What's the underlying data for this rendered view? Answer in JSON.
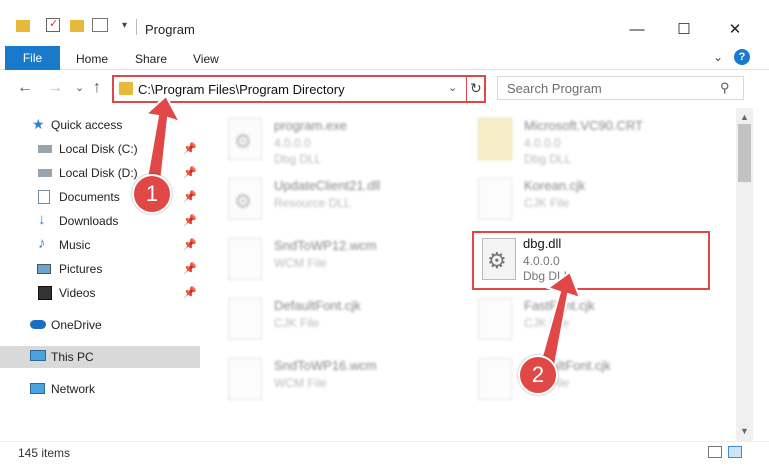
{
  "window": {
    "title": "Program",
    "minimize": "—",
    "maximize": "☐",
    "close": "✕"
  },
  "ribbon": {
    "file": "File",
    "tabs": [
      "Home",
      "Share",
      "View"
    ],
    "expand": "⌄",
    "help": "?"
  },
  "nav": {
    "back": "←",
    "forward": "→",
    "recent": "⌄",
    "up": "↑",
    "address": "C:\\Program Files\\Program Directory",
    "address_dropdown": "⌄",
    "refresh": "↻",
    "search_placeholder": "Search Program",
    "search_icon": "⚲"
  },
  "sidebar": {
    "items": [
      {
        "label": "Quick access",
        "icon": "star-icon",
        "pinned": false
      },
      {
        "label": "Local Disk (C:)",
        "icon": "drive-icon",
        "pinned": true
      },
      {
        "label": "Local Disk (D:)",
        "icon": "drive-icon",
        "pinned": true
      },
      {
        "label": "Documents",
        "icon": "documents-icon",
        "pinned": true
      },
      {
        "label": "Downloads",
        "icon": "download-icon",
        "pinned": true
      },
      {
        "label": "Music",
        "icon": "music-icon",
        "pinned": true
      },
      {
        "label": "Pictures",
        "icon": "pictures-icon",
        "pinned": true
      },
      {
        "label": "Videos",
        "icon": "videos-icon",
        "pinned": true
      },
      {
        "label": "OneDrive",
        "icon": "cloud-icon",
        "pinned": false
      },
      {
        "label": "This PC",
        "icon": "computer-icon",
        "pinned": false,
        "selected": true
      },
      {
        "label": "Network",
        "icon": "network-icon",
        "pinned": false
      }
    ],
    "pin_glyph": "📌"
  },
  "files": [
    {
      "name": "program.exe",
      "line2": "4.0.0.0",
      "line3": "Dbg DLL"
    },
    {
      "name": "Microsoft.VC90.CRT",
      "line2": "4.0.0.0",
      "line3": "Dbg DLL"
    },
    {
      "name": "UpdateClient21.dll",
      "line2": "Resource DLL",
      "line3": ""
    },
    {
      "name": "Korean.cjk",
      "line2": "CJK File",
      "line3": ""
    },
    {
      "name": "SndToWP12.wcm",
      "line2": "WCM File",
      "line3": ""
    },
    {
      "name": "DefaultFont.cjk",
      "line2": "CJK File",
      "line3": ""
    },
    {
      "name": "FastFont.cjk",
      "line2": "CJK File",
      "line3": ""
    },
    {
      "name": "SndToWP16.wcm",
      "line2": "WCM File",
      "line3": ""
    },
    {
      "name": "DefaultFont.cjk",
      "line2": "CJK File",
      "line3": ""
    }
  ],
  "highlighted_file": {
    "name": "dbg.dll",
    "version": "4.0.0.0",
    "description": "Dbg DLL"
  },
  "status": {
    "items": "145 items"
  },
  "annotations": {
    "step1": "1",
    "step2": "2",
    "color": "#e04848"
  }
}
